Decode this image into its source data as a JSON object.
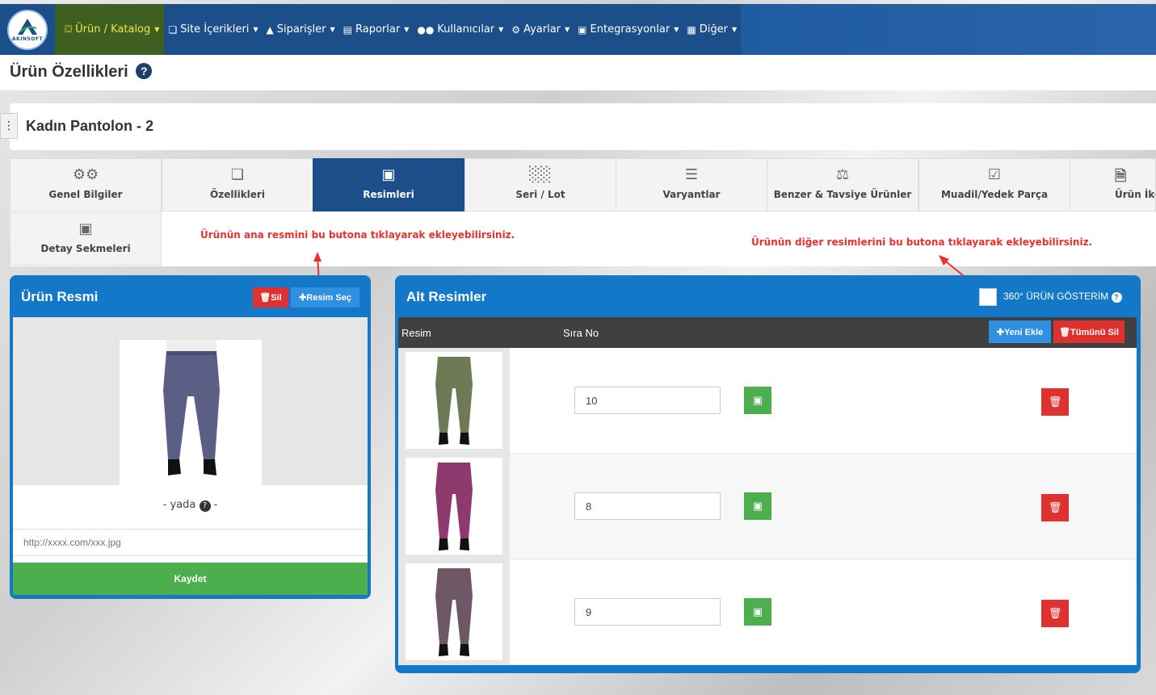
{
  "nav": {
    "logo_text": "AKINSOFT",
    "items": [
      {
        "label": "Ürün / Katalog",
        "icon": "truck-icon",
        "active": true
      },
      {
        "label": "Site İçerikleri",
        "icon": "copy-icon"
      },
      {
        "label": "Siparişler",
        "icon": "cart-icon"
      },
      {
        "label": "Raporlar",
        "icon": "file-icon"
      },
      {
        "label": "Kullanıcılar",
        "icon": "users-icon"
      },
      {
        "label": "Ayarlar",
        "icon": "gears-icon"
      },
      {
        "label": "Entegrasyonlar",
        "icon": "sitemap-icon"
      },
      {
        "label": "Diğer",
        "icon": "grid-icon"
      }
    ]
  },
  "page": {
    "title": "Ürün Özellikleri",
    "help": "?"
  },
  "product": {
    "name": "Kadın Pantolon - 2"
  },
  "tabs": [
    {
      "label": "Genel Bilgiler",
      "icon": "gears-icon"
    },
    {
      "label": "Özellikleri",
      "icon": "copy-icon"
    },
    {
      "label": "Resimleri",
      "icon": "images-icon",
      "active": true
    },
    {
      "label": "Seri / Lot",
      "icon": "barcode-icon"
    },
    {
      "label": "Varyantlar",
      "icon": "bars-icon"
    },
    {
      "label": "Benzer & Tavsiye Ürünler",
      "icon": "balance-icon"
    },
    {
      "label": "Muadil/Yedek Parça",
      "icon": "check-square-icon"
    },
    {
      "label": "Ürün İko",
      "icon": "file-image-icon"
    },
    {
      "label": "Detay Sekmeleri",
      "icon": "sitemap-icon"
    }
  ],
  "annotations": {
    "main_image": "Ürünün ana resmini bu butona tıklayarak ekleyebilirsiniz.",
    "other_images": "Ürünün diğer resimlerini bu butona tıklayarak ekleyebilirsiniz."
  },
  "main_image_panel": {
    "title": "Ürün Resmi",
    "delete_label": "Sil",
    "choose_label": "Resim Seç",
    "or_text": "-  yada",
    "or_suffix": "-",
    "url_placeholder": "http://xxxx.com/xxx.jpg",
    "save_label": "Kaydet",
    "image_color": "#5b5f86"
  },
  "sub_images_panel": {
    "title": "Alt Resimler",
    "show_360_label": "360° ÜRÜN GÖSTERİM",
    "columns": [
      "Resim",
      "Sıra No"
    ],
    "add_label": "Yeni Ekle",
    "delete_all_label": "Tümünü Sil",
    "rows": [
      {
        "order": "10",
        "color": "#6d7a55"
      },
      {
        "order": "8",
        "color": "#8e3a6e"
      },
      {
        "order": "9",
        "color": "#6e5866"
      }
    ]
  }
}
